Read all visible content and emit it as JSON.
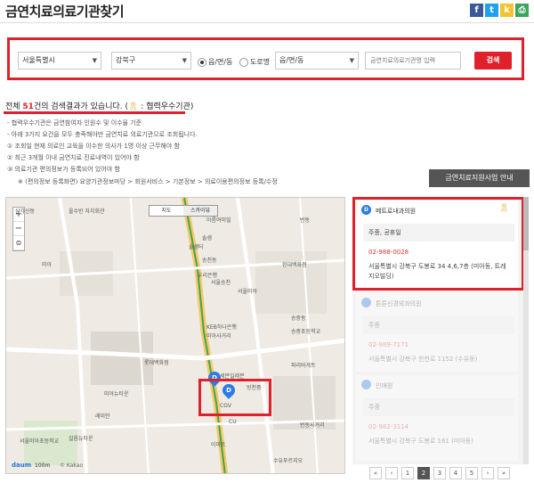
{
  "header": {
    "title": "금연치료의료기관찾기",
    "social": [
      {
        "name": "facebook-icon",
        "glyph": "f",
        "color": "#3b5998"
      },
      {
        "name": "twitter-icon",
        "glyph": "t",
        "color": "#1da1f2"
      },
      {
        "name": "kakaostory-icon",
        "glyph": "k",
        "color": "#f4c430"
      },
      {
        "name": "print-icon",
        "glyph": "⎙",
        "color": "#3ba55c"
      }
    ]
  },
  "search": {
    "sido": "서울특별시",
    "sigungu": "강북구",
    "radio_eupmyeondong": "읍/면/동",
    "radio_road": "도로명",
    "dong": "읍/면/동",
    "keyword_placeholder": "금연치료의료기관명 입력",
    "button": "검색"
  },
  "results_info": {
    "prefix": "전체 ",
    "count": "51",
    "suffix": "건의 검색결과가 있습니다. (",
    "legend": " : 협력우수기관)",
    "notes": [
      "- 협력우수기관은 금연참여자 인원수 및 이수율 기준",
      "- 아래 3가지 요건을 모두 충족해야만 금연치료 의료기관으로 조회됩니다.",
      "① 조회일 현재 의료인 교육을 이수한 의사가 1명 이상 근무해야 함",
      "② 최근 3개월 이내 금연치료 진료내역이 있어야 함",
      "③ 의료기관 편의정보가 등록되어 있어야 함",
      "※ (편의정보 등록화면) 요양기관정보마당 > 회원서비스 > 기본정보 > 의료이용편의정보 등록/수정"
    ],
    "guide_button": "금연치료지원사업 안내"
  },
  "map": {
    "type_map": "지도",
    "type_sky": "스카이뷰",
    "labels": [
      "삼각산동",
      "아름여미빌",
      "솔샘터",
      "송천동",
      "우리은행",
      "서울송천",
      "KEB하나은행",
      "미아사거리",
      "파리바게트",
      "송중동",
      "롯데백화점",
      "서울미아",
      "세븐일레븐",
      "현대백화점",
      "방천중",
      "송중초등학교",
      "CGV",
      "이마트",
      "길음뉴타운",
      "서울미아초등학교",
      "올수빈 자치회관",
      "번동",
      "CU",
      "수유푸르지오",
      "래미안",
      "미아뉴타운",
      "솔샘",
      "미아",
      "번동사거리"
    ],
    "scale": "100m",
    "brand": "daum",
    "copyright": "© Kakao"
  },
  "results": [
    {
      "badge": "D",
      "name": "메트로내과의원",
      "days": "주중, 공휴일",
      "phone": "02-988-0028",
      "address": "서울특별시 강북구 도봉로 34 4,6,7층 (미아동, 트레지오빌딩)"
    },
    {
      "badge": "",
      "name": "튼튼신경외과의원",
      "days": "주중",
      "phone": "02-989-7171",
      "address": "서울특별시 강북구 한천로 1152 (수유동)"
    },
    {
      "badge": "",
      "name": "인애원",
      "days": "주중",
      "phone": "02-982-3114",
      "address": "서울특별시 강북구 도봉로 161 (미아동)"
    }
  ],
  "pagination": [
    "«",
    "‹",
    "1",
    "2",
    "3",
    "4",
    "5",
    "›",
    "»"
  ],
  "pagination_active": "2"
}
